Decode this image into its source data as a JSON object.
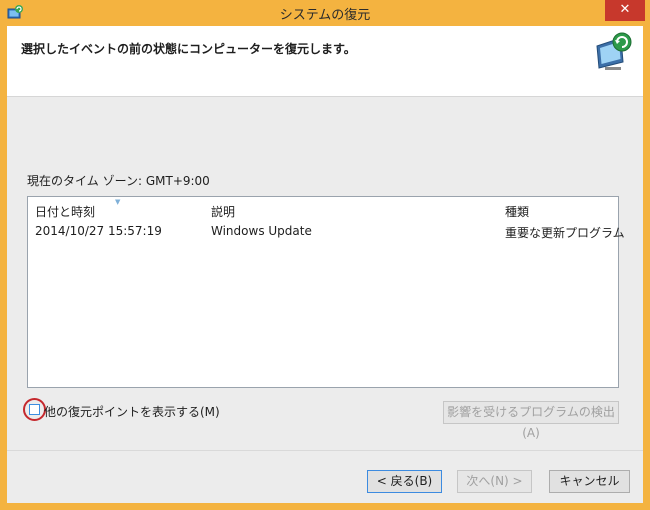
{
  "window": {
    "title": "システムの復元",
    "close_label": "✕",
    "app_icon": "system-restore-icon"
  },
  "header": {
    "instruction": "選択したイベントの前の状態にコンピューターを復元します。",
    "icon": "system-restore-monitor-icon"
  },
  "timezone_label": "現在のタイム ゾーン: GMT+9:00",
  "restore_list": {
    "columns": [
      "日付と時刻",
      "説明",
      "種類"
    ],
    "rows": [
      {
        "datetime": "2014/10/27 15:57:19",
        "description": "Windows Update",
        "type": "重要な更新プログラム"
      }
    ]
  },
  "show_more": {
    "label": "他の復元ポイントを表示する(M)",
    "checked": false
  },
  "buttons": {
    "scan": "影響を受けるプログラムの検出(A)",
    "back": "< 戻る(B)",
    "next": "次へ(N) >",
    "cancel": "キャンセル"
  },
  "colors": {
    "titlebar": "#f4b340",
    "close": "#c7382c",
    "highlight_circle": "#c5282d"
  }
}
